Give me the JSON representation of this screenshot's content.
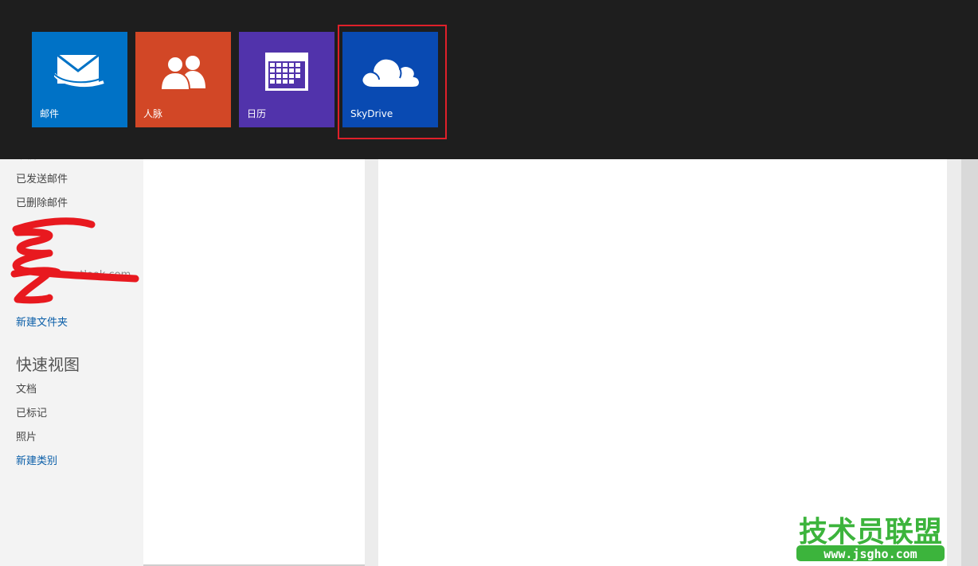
{
  "app_tiles": [
    {
      "name": "mail",
      "label": "邮件",
      "color": "#0072c6",
      "icon": "mail-icon"
    },
    {
      "name": "people",
      "label": "人脉",
      "color": "#d24726",
      "icon": "people-icon"
    },
    {
      "name": "calendar",
      "label": "日历",
      "color": "#5133ab",
      "icon": "calendar-icon"
    },
    {
      "name": "skydrive",
      "label": "SkyDrive",
      "color": "#094ab2",
      "icon": "cloud-icon"
    }
  ],
  "highlight_color": "#e0202a",
  "sidebar": {
    "partial_top_item": "草稿",
    "folders": [
      {
        "label": "已发送邮件"
      },
      {
        "label": "已删除邮件"
      }
    ],
    "redacted_account_fragment": "utlook.com",
    "new_folder_label": "新建文件夹",
    "quick_views_title": "快速视图",
    "quick_views": [
      {
        "label": "文档"
      },
      {
        "label": "已标记"
      },
      {
        "label": "照片"
      }
    ],
    "new_category_label": "新建类别"
  },
  "watermark": {
    "title": "技术员联盟",
    "url": "www.jsgho.com",
    "color": "#3cb43c"
  }
}
